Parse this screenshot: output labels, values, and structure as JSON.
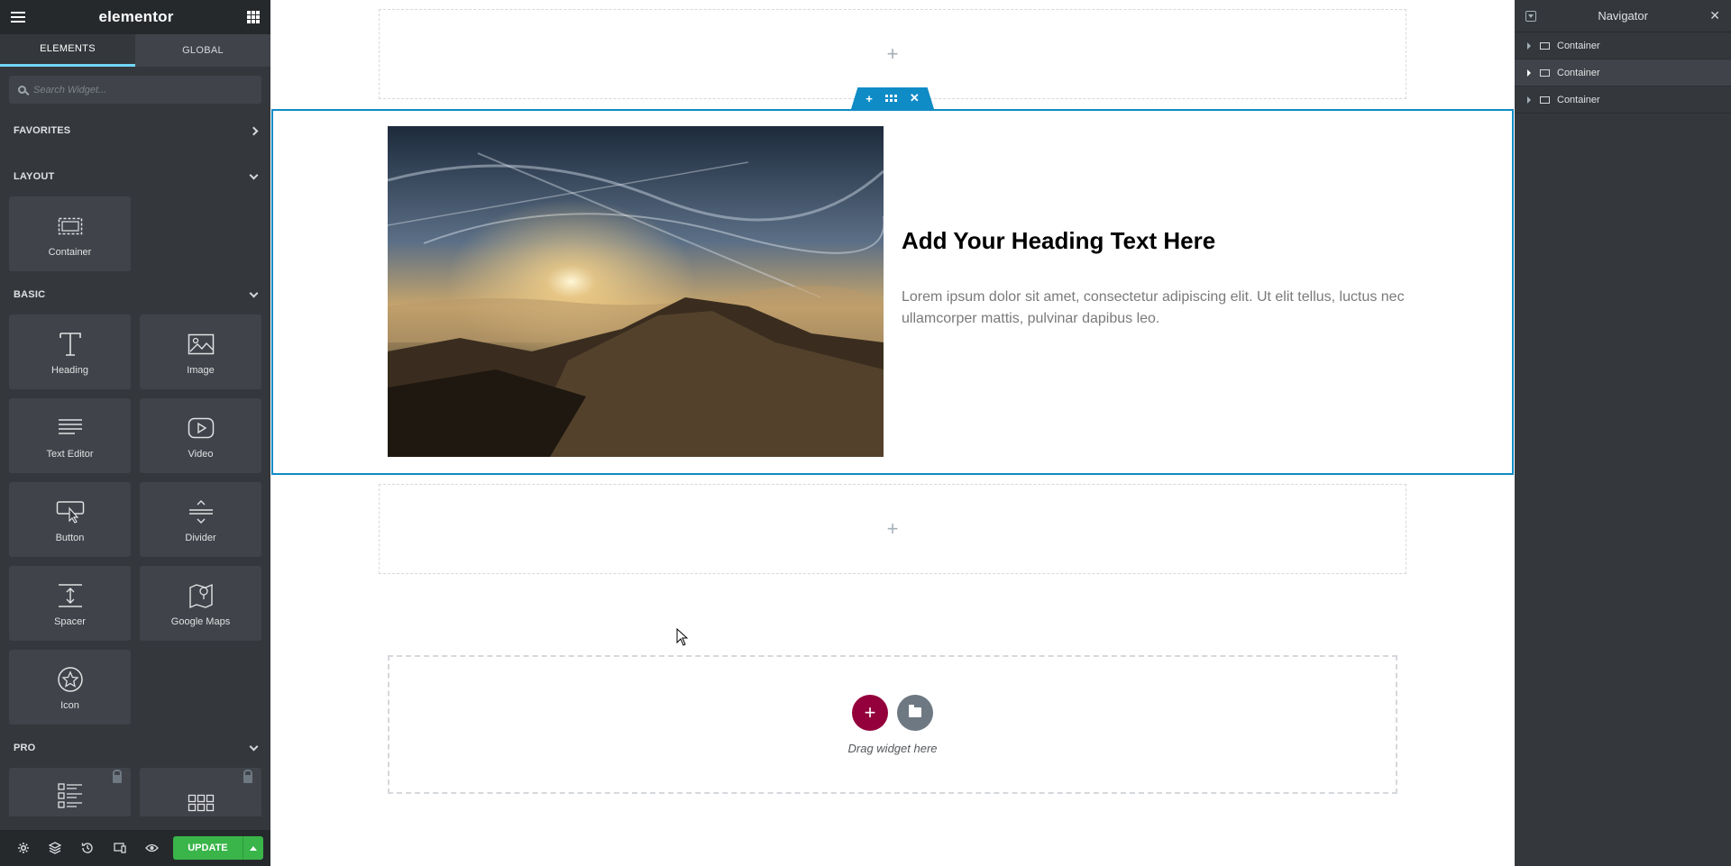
{
  "app": {
    "logo": "elementor"
  },
  "panel": {
    "tabs": [
      {
        "label": "ELEMENTS"
      },
      {
        "label": "GLOBAL"
      }
    ],
    "search": {
      "placeholder": "Search Widget..."
    },
    "categories": {
      "favorites": "FAVORITES",
      "layout": "LAYOUT",
      "basic": "BASIC",
      "pro": "PRO"
    },
    "layout_widgets": [
      {
        "label": "Container",
        "icon": "container-icon"
      }
    ],
    "basic_widgets": [
      {
        "label": "Heading",
        "icon": "heading-icon"
      },
      {
        "label": "Image",
        "icon": "image-icon"
      },
      {
        "label": "Text Editor",
        "icon": "text-editor-icon"
      },
      {
        "label": "Video",
        "icon": "video-icon"
      },
      {
        "label": "Button",
        "icon": "button-icon"
      },
      {
        "label": "Divider",
        "icon": "divider-icon"
      },
      {
        "label": "Spacer",
        "icon": "spacer-icon"
      },
      {
        "label": "Google Maps",
        "icon": "google-maps-icon"
      },
      {
        "label": "Icon",
        "icon": "star-icon"
      }
    ],
    "footer": {
      "update_label": "UPDATE"
    }
  },
  "canvas": {
    "drop_plus": "+",
    "heading": "Add Your Heading Text Here",
    "text": "Lorem ipsum dolor sit amet, consectetur adipiscing elit. Ut elit tellus, luctus nec ullamcorper mattis, pulvinar dapibus leo.",
    "drop_label": "Drag widget here",
    "add_plus": "+"
  },
  "navigator": {
    "title": "Navigator",
    "items": [
      {
        "label": "Container"
      },
      {
        "label": "Container"
      },
      {
        "label": "Container"
      }
    ]
  },
  "colors": {
    "accent": "#0f8bc6",
    "update": "#39b54a",
    "add": "#93003c"
  }
}
